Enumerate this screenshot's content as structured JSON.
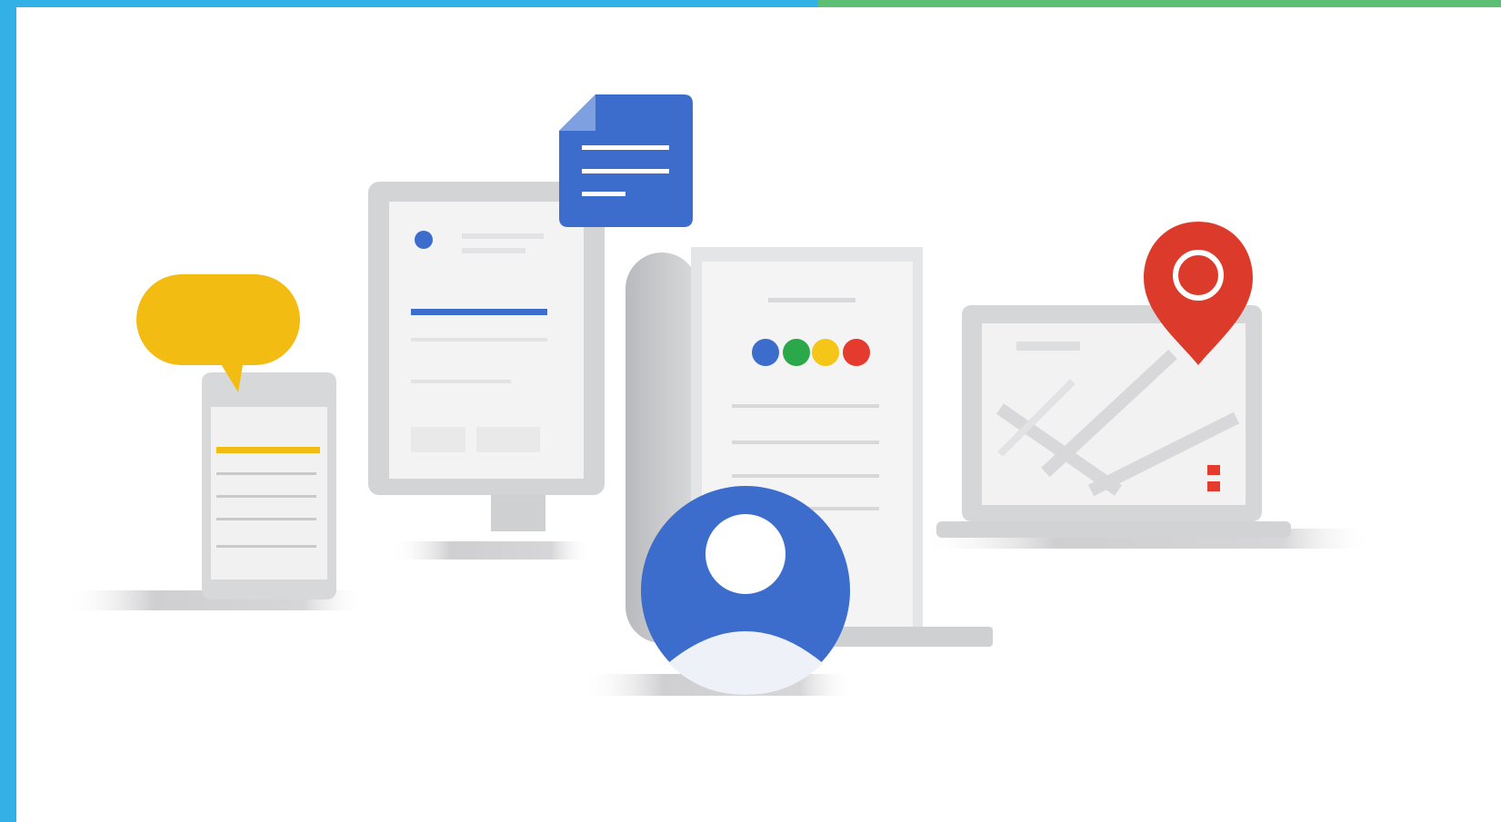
{
  "frame": {
    "left_color": "#33b0e5",
    "top_left_color": "#33b0e5",
    "top_right_color": "#5cbf74"
  },
  "palette": {
    "google_blue": "#3c6ccc",
    "google_green": "#2ba84a",
    "google_yellow": "#f5c518",
    "google_red": "#e53a2e",
    "chat_yellow": "#f3bc12",
    "pin_red": "#dc3b2b",
    "device_gray": "#d8d9db",
    "line_gray": "#c9c9cb"
  },
  "icons": [
    "chat-bubble-icon",
    "smartphone-icon",
    "document-icon",
    "desktop-monitor-icon",
    "tablet-icon",
    "google-dots-icon",
    "user-avatar-icon",
    "laptop-icon",
    "map-pin-icon",
    "map-icon"
  ]
}
